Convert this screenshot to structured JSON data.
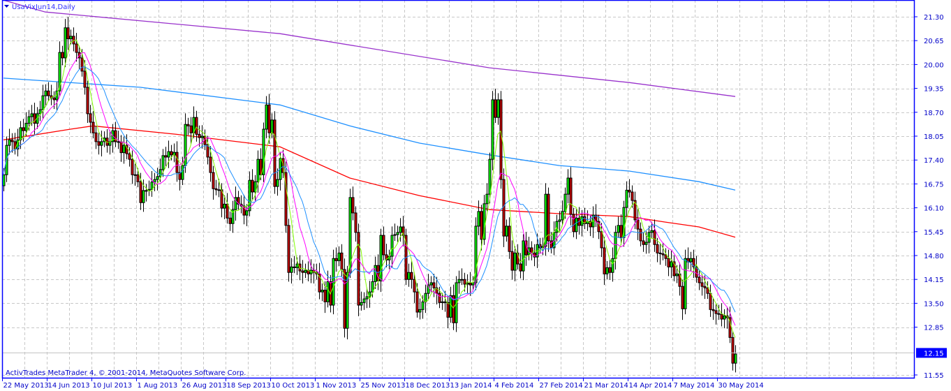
{
  "header": {
    "title": "UsaVixJun14,Daily"
  },
  "footer": {
    "copyright": "ActivTrades MetaTrader 4, © 2001-2014, MetaQuotes Software Corp."
  },
  "colors": {
    "axis": "#0000ff",
    "grid": "#c8c8c8",
    "bull": "#00ff00",
    "bear": "#d00000",
    "ma_fast": "#80ff00",
    "ma_mid": "#ff00ff",
    "ma_slow": "#1e90ff",
    "ma_long_red": "#ff0000",
    "ma_long_blue": "#1e90ff",
    "ma_long_purple": "#9932cc",
    "bid_box": "#0000ff"
  },
  "chart_data": {
    "type": "candlestick",
    "symbol": "UsaVixJun14",
    "timeframe": "Daily",
    "ylim": [
      11.55,
      21.3
    ],
    "y_ticks": [
      "21.30",
      "20.65",
      "20.00",
      "19.35",
      "18.70",
      "18.05",
      "17.40",
      "16.75",
      "16.10",
      "15.45",
      "14.80",
      "14.15",
      "13.50",
      "12.85",
      "11.55"
    ],
    "y_tick_values": [
      21.3,
      20.65,
      20.0,
      19.35,
      18.7,
      18.05,
      17.4,
      16.75,
      16.1,
      15.45,
      14.8,
      14.15,
      13.5,
      12.85,
      11.55
    ],
    "current_price_label": "12.15",
    "current_price": 12.15,
    "x_ticks": [
      "22 May 2013",
      "14 Jun 2013",
      "10 Jul 2013",
      "1 Aug 2013",
      "26 Aug 2013",
      "18 Sep 2013",
      "10 Oct 2013",
      "1 Nov 2013",
      "25 Nov 2013",
      "18 Dec 2013",
      "13 Jan 2014",
      "4 Feb 2014",
      "27 Feb 2014",
      "21 Mar 2014",
      "14 Apr 2014",
      "7 May 2014",
      "30 May 2014"
    ],
    "x_tick_every_bars": 16,
    "grid": true,
    "closes": [
      17.0,
      17.8,
      17.95,
      17.9,
      17.7,
      17.95,
      18.28,
      18.2,
      18.4,
      18.58,
      18.66,
      18.4,
      18.66,
      18.77,
      19.15,
      19.28,
      19.15,
      19.09,
      19.04,
      19.28,
      20.33,
      20.18,
      21.0,
      20.7,
      20.77,
      20.56,
      20.33,
      20.18,
      19.82,
      19.38,
      18.66,
      18.43,
      18.14,
      17.9,
      17.8,
      17.9,
      18.0,
      17.8,
      17.9,
      18.2,
      17.9,
      17.9,
      17.6,
      17.8,
      17.57,
      17.42,
      17.0,
      17.0,
      16.81,
      16.24,
      16.57,
      16.57,
      16.6,
      16.8,
      16.87,
      16.95,
      17.14,
      17.52,
      17.48,
      17.63,
      17.54,
      17.61,
      17.06,
      16.87,
      17.25,
      18.37,
      18.33,
      18.14,
      18.56,
      18.1,
      18.01,
      18.05,
      17.82,
      17.48,
      17.06,
      16.62,
      16.59,
      16.59,
      16.09,
      16.2,
      15.82,
      15.67,
      16.05,
      16.38,
      16.2,
      16.15,
      15.9,
      16.02,
      16.85,
      16.53,
      16.81,
      17.42,
      17.0,
      18.24,
      18.9,
      18.14,
      18.49,
      16.68,
      16.87,
      17.44,
      17.06,
      15.62,
      14.34,
      14.49,
      14.47,
      14.57,
      14.38,
      14.34,
      14.4,
      14.3,
      14.4,
      14.34,
      14.3,
      13.81,
      13.86,
      13.54,
      14.09,
      13.45,
      14.72,
      14.66,
      14.87,
      14.42,
      12.82,
      14.34,
      16.38,
      15.96,
      15.43,
      13.45,
      13.52,
      13.62,
      13.68,
      13.81,
      14.09,
      14.53,
      14.11,
      15.35,
      14.82,
      14.68,
      14.78,
      15.35,
      15.37,
      15.43,
      15.58,
      15.35,
      14.15,
      14.34,
      14.15,
      13.81,
      13.26,
      13.33,
      13.54,
      13.77,
      14.0,
      14.06,
      13.92,
      13.77,
      13.52,
      13.54,
      13.52,
      13.12,
      13.71,
      12.97,
      14.06,
      14.15,
      14.15,
      14.02,
      14.05,
      14.0,
      14.06,
      15.6,
      16.0,
      15.24,
      16.21,
      16.47,
      17.42,
      19.04,
      18.56,
      19.04,
      16.87,
      15.33,
      15.6,
      14.91,
      14.4,
      14.87,
      14.57,
      14.38,
      15.2,
      14.82,
      15.01,
      14.87,
      14.76,
      15.1,
      15.01,
      15.05,
      16.47,
      15.2,
      15.01,
      15.43,
      15.73,
      15.77,
      16.0,
      16.47,
      16.91,
      15.92,
      15.45,
      15.82,
      15.62,
      15.86,
      15.67,
      15.73,
      15.58,
      15.9,
      15.73,
      15.45,
      15.01,
      14.3,
      14.47,
      14.34,
      14.72,
      15.43,
      15.62,
      15.29,
      16.11,
      16.58,
      16.53,
      16.3,
      15.77,
      15.52,
      15.2,
      15.1,
      15.16,
      15.43,
      15.48,
      15.1,
      14.87,
      14.85,
      14.82,
      14.72,
      14.49,
      14.63,
      14.25,
      14.3,
      13.96,
      13.35,
      14.72,
      14.63,
      14.72,
      14.49,
      14.21,
      14.06,
      13.96,
      13.92,
      13.77,
      13.33,
      13.3,
      13.22,
      13.2,
      13.07,
      13.16,
      13.11,
      12.57,
      11.87,
      12.12
    ],
    "computed_mas": [
      {
        "name": "ma-fast",
        "period": 5,
        "color_key": "ma_fast"
      },
      {
        "name": "ma-mid",
        "period": 10,
        "color_key": "ma_mid"
      },
      {
        "name": "ma-slow",
        "period": 15,
        "color_key": "ma_slow"
      }
    ],
    "long_mas": [
      {
        "name": "ma-long-purple",
        "color_key": "ma_long_purple",
        "points": [
          [
            0,
            21.75
          ],
          [
            15,
            21.43
          ],
          [
            99,
            20.84
          ],
          [
            174,
            19.91
          ],
          [
            224,
            19.51
          ],
          [
            262,
            19.13
          ]
        ]
      },
      {
        "name": "ma-long-blue",
        "color_key": "ma_long_blue",
        "points": [
          [
            0,
            19.63
          ],
          [
            49,
            19.38
          ],
          [
            99,
            18.9
          ],
          [
            124,
            18.33
          ],
          [
            149,
            17.86
          ],
          [
            174,
            17.54
          ],
          [
            199,
            17.25
          ],
          [
            224,
            17.1
          ],
          [
            249,
            16.81
          ],
          [
            262,
            16.58
          ]
        ]
      },
      {
        "name": "ma-long-red",
        "color_key": "ma_long_red",
        "points": [
          [
            0,
            17.95
          ],
          [
            24,
            18.24
          ],
          [
            32,
            18.33
          ],
          [
            62,
            18.1
          ],
          [
            99,
            17.76
          ],
          [
            124,
            16.91
          ],
          [
            149,
            16.43
          ],
          [
            174,
            16.05
          ],
          [
            199,
            15.94
          ],
          [
            224,
            15.86
          ],
          [
            237,
            15.71
          ],
          [
            249,
            15.58
          ],
          [
            262,
            15.3
          ]
        ]
      }
    ]
  }
}
